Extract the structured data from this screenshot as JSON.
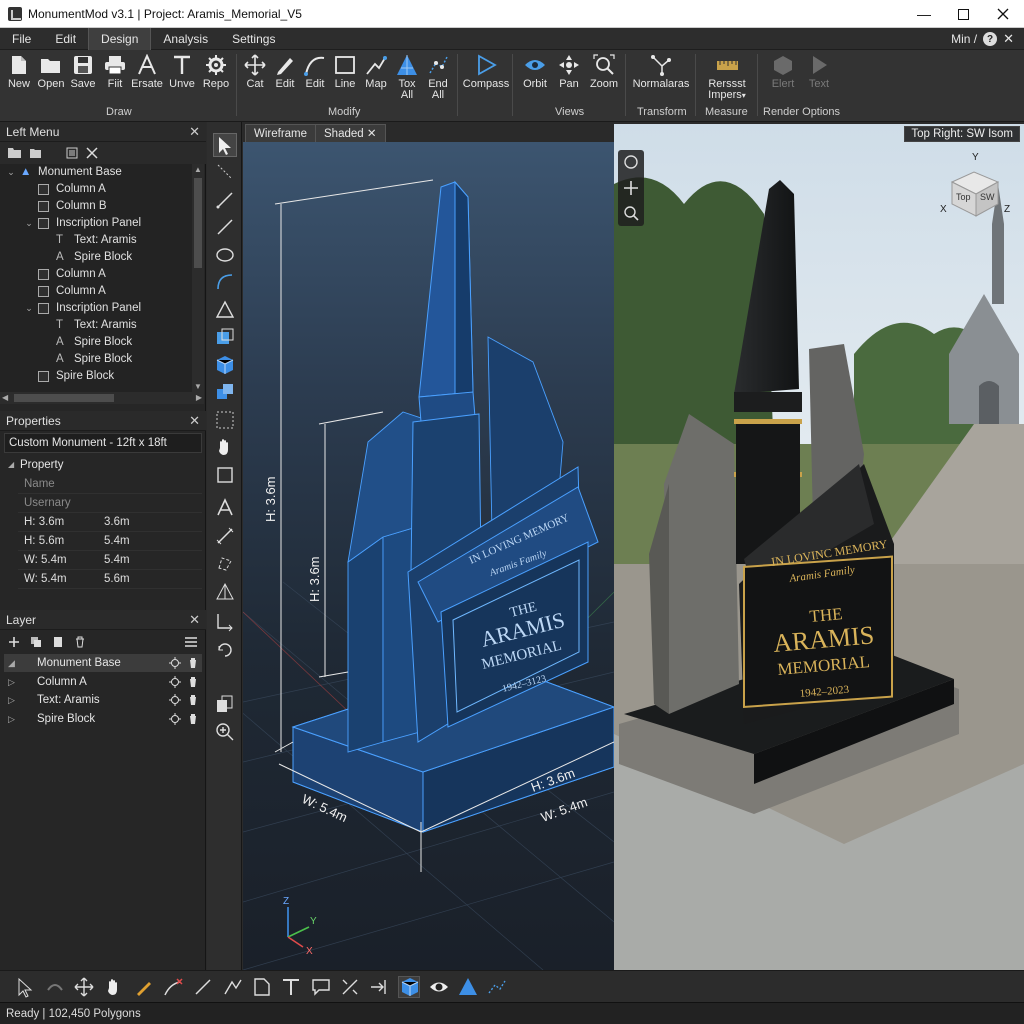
{
  "window": {
    "title": "MonumentMod v3.1 | Project: Aramis_Memorial_V5",
    "controls": [
      "minimize",
      "maximize",
      "close"
    ]
  },
  "menubar": {
    "items": [
      "File",
      "Edit",
      "Design",
      "Analysis",
      "Settings"
    ],
    "active": "Design",
    "right_label": "Min /"
  },
  "ribbon": {
    "draw": {
      "label": "Draw",
      "buttons": [
        "New",
        "Open",
        "Save",
        "Fiit",
        "Ersate",
        "Unve",
        "Repo"
      ]
    },
    "modify": {
      "label": "Modify",
      "buttons": [
        {
          "line1": "Cat",
          "line2": ""
        },
        {
          "line1": "Edit",
          "line2": ""
        },
        {
          "line1": "Edit",
          "line2": ""
        },
        {
          "line1": "Line",
          "line2": ""
        },
        {
          "line1": "Map",
          "line2": ""
        },
        {
          "line1": "Tox",
          "line2": "All"
        },
        {
          "line1": "End",
          "line2": "All"
        }
      ],
      "compass": "Compass"
    },
    "views": {
      "label": "Views",
      "buttons": [
        "Orbit",
        "Pan",
        "Zoom"
      ]
    },
    "transform": {
      "label": "Transform",
      "button": "Normalaras"
    },
    "measure": {
      "label": "Measure",
      "line1": "Rerssst",
      "line2": "Impers"
    },
    "render": {
      "label": "Render Options",
      "buttons": [
        "Elert",
        "Text"
      ]
    }
  },
  "left_menu": {
    "header": "Left Menu",
    "tree": [
      {
        "label": "Monument Base",
        "level": 0,
        "expanded": true,
        "icon": "monument-icon"
      },
      {
        "label": "Column A",
        "level": 1,
        "icon": "box-icon"
      },
      {
        "label": "Column B",
        "level": 1,
        "icon": "box-icon"
      },
      {
        "label": "Inscription Panel",
        "level": 1,
        "expanded": true,
        "icon": "panel-icon"
      },
      {
        "label": "Text: Aramis",
        "level": 2,
        "icon": "text-icon"
      },
      {
        "label": "Spire Block",
        "level": 2,
        "icon": "spire-icon"
      },
      {
        "label": "Column A",
        "level": 1,
        "icon": "box-icon"
      },
      {
        "label": "Column A",
        "level": 1,
        "icon": "box-icon"
      },
      {
        "label": "Inscription Panel",
        "level": 1,
        "expanded": true,
        "icon": "panel-icon"
      },
      {
        "label": "Text: Aramis",
        "level": 2,
        "icon": "text-icon"
      },
      {
        "label": "Spire Block",
        "level": 2,
        "icon": "spire-icon"
      },
      {
        "label": "Spire Block",
        "level": 2,
        "icon": "spire-icon"
      },
      {
        "label": "Spire Block",
        "level": 1,
        "icon": "box-icon"
      }
    ]
  },
  "properties": {
    "header": "Properties",
    "object": "Custom Monument - 12ft x 18ft",
    "section": "Property",
    "rows": [
      {
        "key": "Name",
        "value": "",
        "placeholder": true
      },
      {
        "key": "Usernary",
        "value": "",
        "placeholder": true
      },
      {
        "key": "H: 3.6m",
        "value": "3.6m"
      },
      {
        "key": "H: 5.6m",
        "value": "5.4m"
      },
      {
        "key": "W: 5.4m",
        "value": "5.4m"
      },
      {
        "key": "W: 5.4m",
        "value": "5.6m"
      }
    ]
  },
  "layer": {
    "header": "Layer",
    "rows": [
      {
        "label": "Monument Base",
        "selected": true
      },
      {
        "label": "Column A",
        "selected": false
      },
      {
        "label": "Text: Aramis",
        "selected": false
      },
      {
        "label": "Spire Block",
        "selected": false
      }
    ]
  },
  "viewport": {
    "tabs": [
      "Wireframe",
      "Shaded"
    ],
    "right_label": "Top Right: SW Isom",
    "dimensions": {
      "height_outer": "H: 3.6m",
      "height_inner": "H: 3.6m",
      "width_left": "W: 5.4m",
      "height_bottom": "H: 3.6m",
      "width_bottom": "W: 5.4m"
    },
    "inscription": {
      "top_line1": "IN LOVING MEMORY",
      "top_line2": "Aramis Family",
      "plaque_line1": "THE",
      "plaque_line2": "ARAMIS",
      "plaque_line3": "MEMORIAL",
      "plaque_dates_wire": "1942–3123",
      "plaque_dates_shaded": "1942–2023",
      "top_line1_shaded": "IN LOVINC MEMORY"
    },
    "viewcube": {
      "top": "Top",
      "side": "SW",
      "axis_x": "X",
      "axis_y": "Y",
      "axis_z": "Z"
    },
    "triad": {
      "x": "X",
      "y": "Y",
      "z": "Z"
    }
  },
  "status": {
    "text": "Ready | 102,450 Polygons"
  },
  "colors": {
    "wire": "#3d8fe6",
    "accent": "#4a9ee8",
    "gold": "#c9a24a"
  }
}
